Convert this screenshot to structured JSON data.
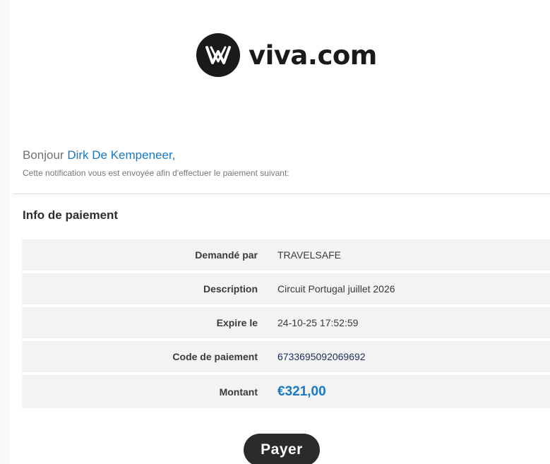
{
  "brand": {
    "name": "viva.com",
    "logo_icon": "viva-logo-icon",
    "colors": {
      "dark": "#1a1a1a",
      "accent": "#1778c6"
    }
  },
  "greeting": {
    "prefix": "Bonjour ",
    "name": "Dirk De Kempeneer,",
    "subline": "Cette notification vous est envoyée afin d'effectuer le paiement suivant:"
  },
  "payment_info": {
    "title": "Info de paiement",
    "rows": [
      {
        "label": "Demandé par",
        "value": "TRAVELSAFE"
      },
      {
        "label": "Description",
        "value": "Circuit Portugal juillet 2026"
      },
      {
        "label": "Expire le",
        "value": "24-10-25 17:52:59"
      },
      {
        "label": "Code de paiement",
        "value": "6733695092069692"
      },
      {
        "label": "Montant",
        "value": "€321,00"
      }
    ]
  },
  "actions": {
    "pay_label": "Payer"
  }
}
